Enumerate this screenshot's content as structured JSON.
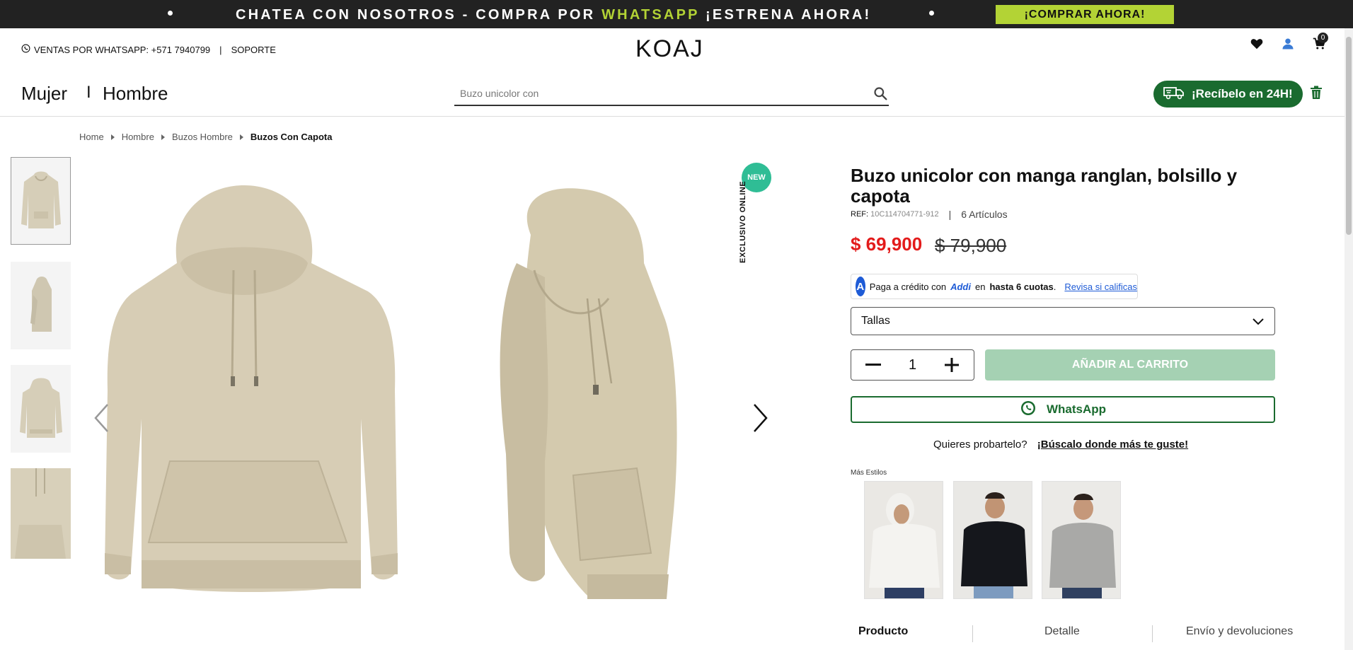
{
  "promo": {
    "message_start": "CHATEA CON NOSOTROS - COMPRA POR ",
    "message_highlight": "WHATSAPP",
    "message_end": " ¡ESTRENA AHORA!",
    "cta_label": "¡COMPRAR AHORA!",
    "highlight_color": "#b3d335"
  },
  "header": {
    "sales_label": "VENTAS POR WHATSAPP: ",
    "sales_phone": "+571 7940799",
    "separator": "|",
    "support_label": "SOPORTE",
    "logo": "KOAJ",
    "cart_count": "0",
    "icons": [
      "heart-icon",
      "user-icon",
      "cart-icon"
    ]
  },
  "nav": {
    "mujer": "Mujer",
    "separator": "I",
    "hombre": "Hombre"
  },
  "search": {
    "placeholder": "Buzo unicolor con"
  },
  "delivery": {
    "label": "¡Recíbelo en 24H!",
    "color": "#1a6b2f"
  },
  "breadcrumb": {
    "items": [
      "Home",
      "Hombre",
      "Buzos Hombre",
      "Buzos Con Capota"
    ]
  },
  "gallery": {
    "badge": "NEW",
    "badge_color": "#2fbd95",
    "exclusive_label": "EXCLUSIVO ONLINE",
    "thumbnail_count": 4
  },
  "product": {
    "title": "Buzo unicolor con manga ranglan, bolsillo y capota",
    "ref_label": "REF:",
    "ref_code": "10C114704771-912",
    "ref_separator": "|",
    "articles": "6 Artículos",
    "price": "$ 69,900",
    "old_price": "$ 79,900",
    "price_color": "#e31b1b"
  },
  "addi": {
    "logo_letter": "A",
    "text_start": "Paga a crédito con",
    "brand": "Addi",
    "text_mid": "en",
    "text_bold": "hasta 6 cuotas",
    "text_end": ".",
    "link": "Revisa si calificas"
  },
  "sizes": {
    "label": "Tallas"
  },
  "cart": {
    "quantity": "1",
    "add_label": "AÑADIR AL CARRITO"
  },
  "whatsapp": {
    "label": "WhatsApp"
  },
  "tryon": {
    "question": "Quieres probartelo?",
    "link": "¡Búscalo donde más te guste!"
  },
  "styles": {
    "label": "Más Estilos",
    "items": [
      "white-hoodie",
      "black-hoodie",
      "grey-hoodie"
    ]
  },
  "tabs": {
    "items": [
      "Producto",
      "Detalle",
      "Envío y devoluciones"
    ]
  }
}
